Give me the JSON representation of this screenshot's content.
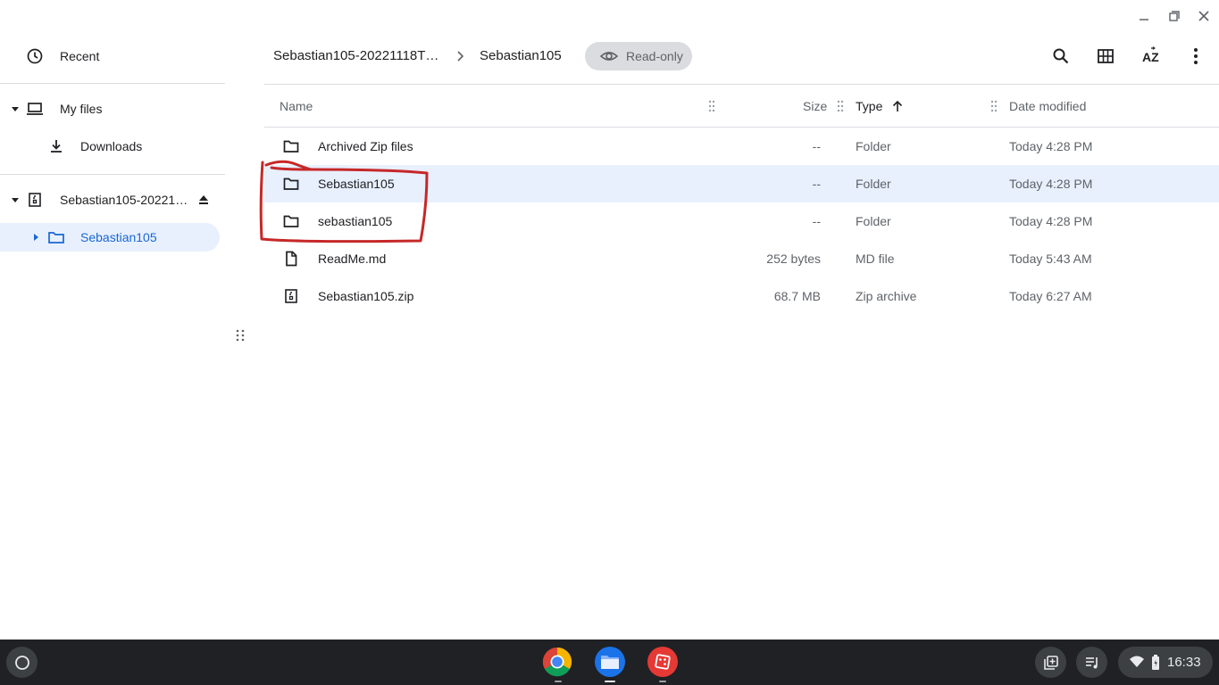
{
  "window": {
    "controls": {
      "minimize": "minimize-icon",
      "restore": "restore-icon",
      "close": "close-icon"
    }
  },
  "sidebar": {
    "recent": {
      "label": "Recent",
      "icon": "clock-icon"
    },
    "my_files": {
      "label": "My files",
      "icon": "laptop-icon"
    },
    "downloads": {
      "label": "Downloads",
      "icon": "download-icon"
    },
    "archive": {
      "label": "Sebastian105-20221…",
      "icon": "zip-icon",
      "eject_icon": "eject-icon"
    },
    "archive_child": {
      "label": "Sebastian105",
      "icon": "folder-icon"
    }
  },
  "breadcrumb": {
    "items": [
      "Sebastian105-20221118T…",
      "Sebastian105"
    ],
    "separator_icon": "chevron-right-icon"
  },
  "readonly_chip": {
    "label": "Read-only",
    "icon": "eye-icon"
  },
  "toolbar": {
    "search_icon": "search-icon",
    "grid_icon": "grid-view-icon",
    "sort_icon": "sort-az-icon",
    "more_icon": "more-vert-icon"
  },
  "table": {
    "columns": {
      "name": "Name",
      "size": "Size",
      "type": "Type",
      "date": "Date modified"
    },
    "sort_icon": "arrow-up-icon",
    "rows": [
      {
        "name": "Archived Zip files",
        "size": "--",
        "type": "Folder",
        "date": "Today 4:28 PM",
        "icon": "folder-icon"
      },
      {
        "name": "Sebastian105",
        "size": "--",
        "type": "Folder",
        "date": "Today 4:28 PM",
        "icon": "folder-icon"
      },
      {
        "name": "sebastian105",
        "size": "--",
        "type": "Folder",
        "date": "Today 4:28 PM",
        "icon": "folder-icon"
      },
      {
        "name": "ReadMe.md",
        "size": "252 bytes",
        "type": "MD file",
        "date": "Today 5:43 AM",
        "icon": "file-icon"
      },
      {
        "name": "Sebastian105.zip",
        "size": "68.7 MB",
        "type": "Zip archive",
        "date": "Today 6:27 AM",
        "icon": "zip-icon"
      }
    ]
  },
  "shelf": {
    "launcher_icon": "launcher-icon",
    "apps": [
      "chrome-icon",
      "files-app-icon",
      "app-icon"
    ],
    "tray": {
      "time": "16:33",
      "holding_space_icon": "holding-space-icon",
      "media_icon": "media-queue-icon",
      "wifi_icon": "wifi-icon",
      "battery_icon": "battery-icon"
    }
  },
  "colors": {
    "selected_bg": "#e8f0fe",
    "accent": "#1967d2",
    "annotation": "#c62828",
    "shelf_bg": "#202124"
  }
}
